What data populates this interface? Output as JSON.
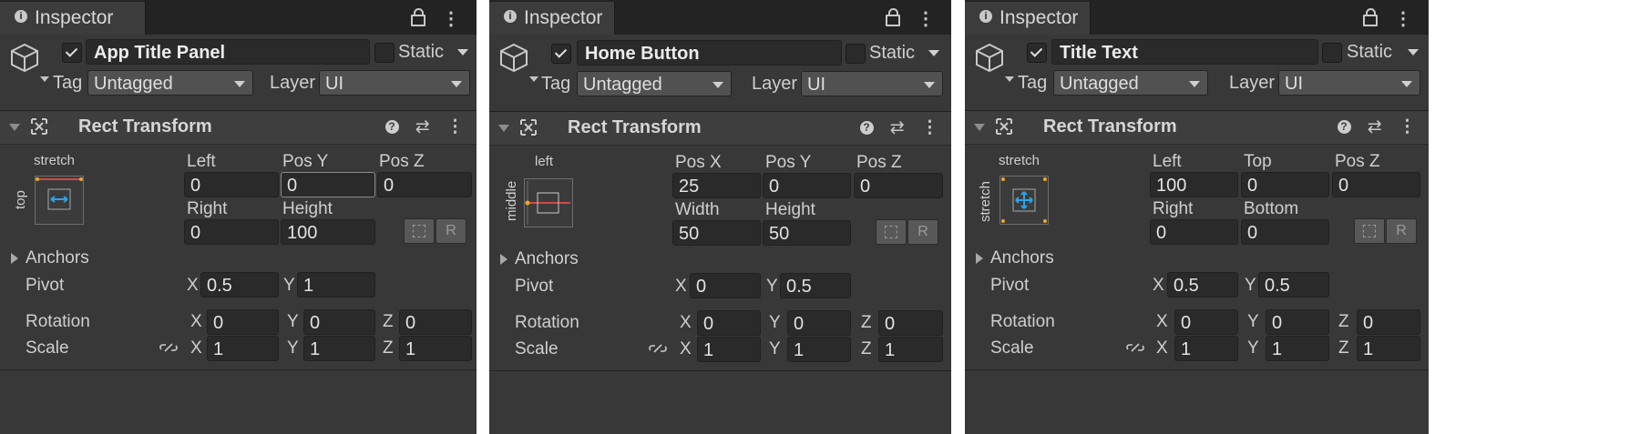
{
  "panels": [
    {
      "tab_label": "Inspector",
      "object_name": "App Title Panel",
      "active_checked": true,
      "static_label": "Static",
      "tag_label": "Tag",
      "tag_value": "Untagged",
      "layer_label": "Layer",
      "layer_value": "UI",
      "component_title": "Rect Transform",
      "anchor_top_label": "stretch",
      "anchor_side_label": "top",
      "anchor_preset": "top-stretch",
      "row1_labels": [
        "Left",
        "Pos Y",
        "Pos Z"
      ],
      "row1_values": [
        "0",
        "0",
        "0"
      ],
      "row2_labels": [
        "Right",
        "Height"
      ],
      "row2_values": [
        "0",
        "100"
      ],
      "anchors_label": "Anchors",
      "pivot_label": "Pivot",
      "pivot_x": "0.5",
      "pivot_y": "1",
      "rotation_label": "Rotation",
      "rotation": [
        "0",
        "0",
        "0"
      ],
      "scale_label": "Scale",
      "scale": [
        "1",
        "1",
        "1"
      ]
    },
    {
      "tab_label": "Inspector",
      "object_name": "Home Button",
      "active_checked": true,
      "static_label": "Static",
      "tag_label": "Tag",
      "tag_value": "Untagged",
      "layer_label": "Layer",
      "layer_value": "UI",
      "component_title": "Rect Transform",
      "anchor_top_label": "left",
      "anchor_side_label": "middle",
      "anchor_preset": "middle-left",
      "row1_labels": [
        "Pos X",
        "Pos Y",
        "Pos Z"
      ],
      "row1_values": [
        "25",
        "0",
        "0"
      ],
      "row2_labels": [
        "Width",
        "Height"
      ],
      "row2_values": [
        "50",
        "50"
      ],
      "anchors_label": "Anchors",
      "pivot_label": "Pivot",
      "pivot_x": "0",
      "pivot_y": "0.5",
      "rotation_label": "Rotation",
      "rotation": [
        "0",
        "0",
        "0"
      ],
      "scale_label": "Scale",
      "scale": [
        "1",
        "1",
        "1"
      ]
    },
    {
      "tab_label": "Inspector",
      "object_name": "Title Text",
      "active_checked": true,
      "static_label": "Static",
      "tag_label": "Tag",
      "tag_value": "Untagged",
      "layer_label": "Layer",
      "layer_value": "UI",
      "component_title": "Rect Transform",
      "anchor_top_label": "stretch",
      "anchor_side_label": "stretch",
      "anchor_preset": "stretch-stretch",
      "row1_labels": [
        "Left",
        "Top",
        "Pos Z"
      ],
      "row1_values": [
        "100",
        "0",
        "0"
      ],
      "row2_labels": [
        "Right",
        "Bottom"
      ],
      "row2_values": [
        "0",
        "0"
      ],
      "anchors_label": "Anchors",
      "pivot_label": "Pivot",
      "pivot_x": "0.5",
      "pivot_y": "0.5",
      "rotation_label": "Rotation",
      "rotation": [
        "0",
        "0",
        "0"
      ],
      "scale_label": "Scale",
      "scale": [
        "1",
        "1",
        "1"
      ]
    }
  ],
  "axis_labels": {
    "x": "X",
    "y": "Y",
    "z": "Z"
  },
  "raw_button_label": "R",
  "colors": {
    "panel_bg": "#383838",
    "field_bg": "#2a2a2a",
    "anchor_blue": "#2ba3e8",
    "anchor_red": "#d44848",
    "anchor_gold": "#e8a92b"
  }
}
